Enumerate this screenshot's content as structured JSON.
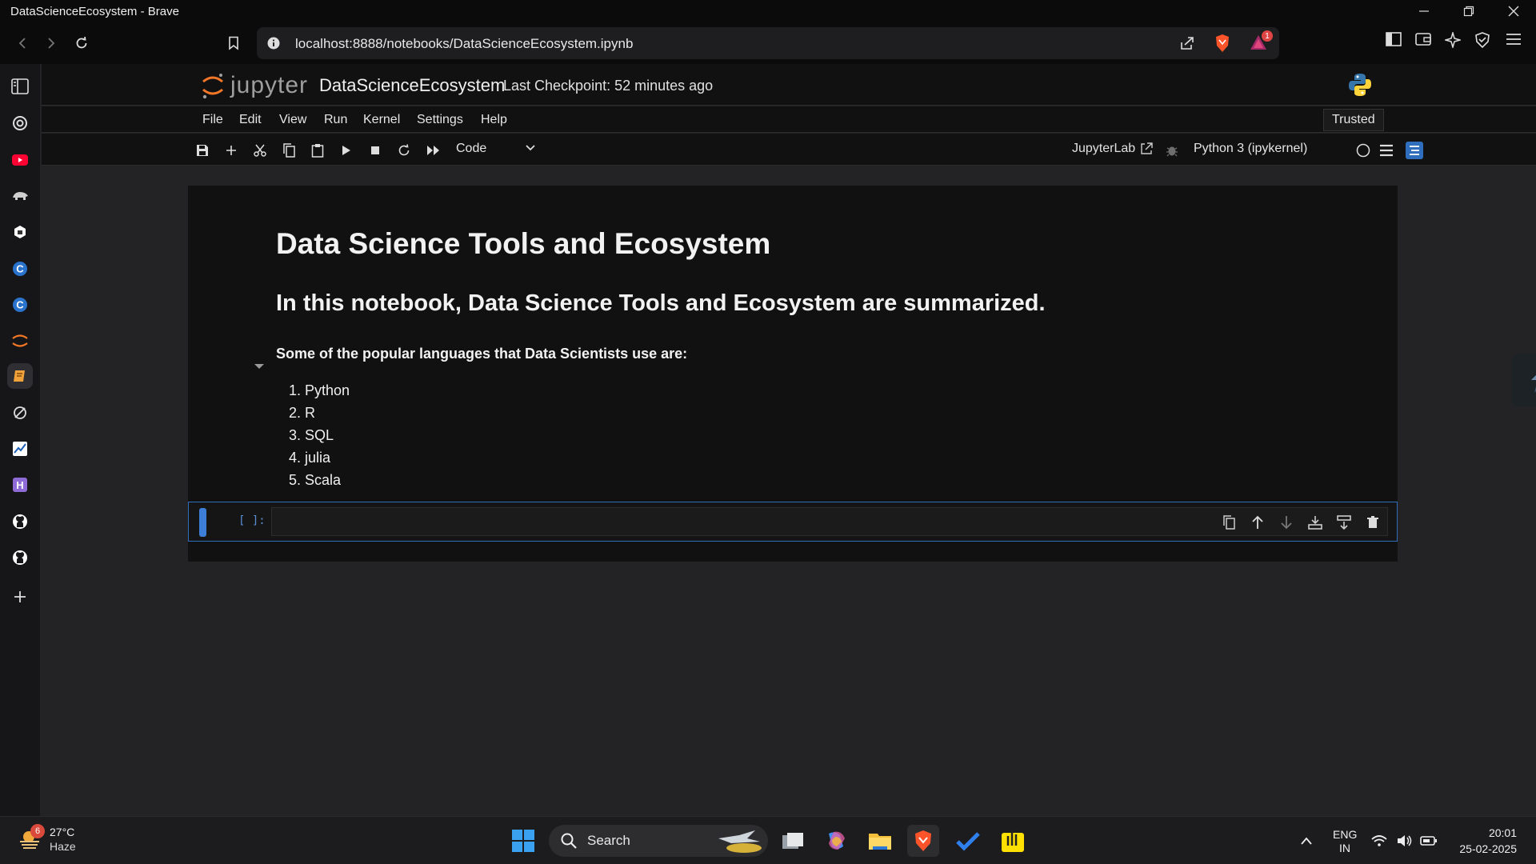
{
  "window": {
    "title": "DataScienceEcosystem - Brave"
  },
  "browser": {
    "url": "localhost:8888/notebooks/DataScienceEcosystem.ipynb",
    "rewards_badge": "1"
  },
  "jupyter": {
    "logo_text": "jupyter",
    "notebook_name": "DataScienceEcosystem",
    "checkpoint": "Last Checkpoint: 52 minutes ago",
    "trusted": "Trusted",
    "menu": [
      "File",
      "Edit",
      "View",
      "Run",
      "Kernel",
      "Settings",
      "Help"
    ],
    "cell_type": "Code",
    "jupyterlab_link": "JupyterLab",
    "kernel": "Python 3 (ipykernel)"
  },
  "notebook": {
    "h1": "Data Science Tools and Ecosystem",
    "h2": "In this notebook, Data Science Tools and Ecosystem are summarized.",
    "bold_text": "Some of the popular languages that Data Scientists use are:",
    "languages": [
      "1. Python",
      "2. R",
      "3. SQL",
      "4. julia",
      "5. Scala"
    ],
    "code_prompt": "[ ]:"
  },
  "taskbar": {
    "weather_temp": "27°C",
    "weather_cond": "Haze",
    "weather_badge": "6",
    "search_label": "Search",
    "lang_top": "ENG",
    "lang_bottom": "IN",
    "time": "20:01",
    "date": "25-02-2025"
  },
  "colors": {
    "accent": "#3d7fd8",
    "jupyter_orange": "#f37726",
    "brave_orange": "#fb542b"
  }
}
